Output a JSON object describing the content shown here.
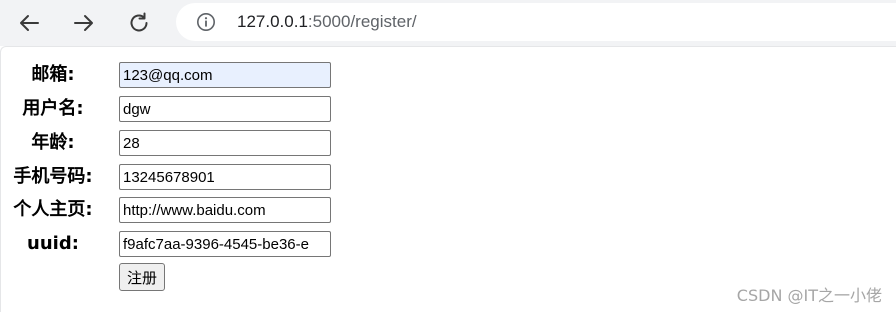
{
  "browser": {
    "url_host": "127.0.0.1",
    "url_path": ":5000/register/"
  },
  "form": {
    "fields": [
      {
        "label": "邮箱:",
        "value": "123@qq.com"
      },
      {
        "label": "用户名:",
        "value": "dgw"
      },
      {
        "label": "年龄:",
        "value": "28"
      },
      {
        "label": "手机号码:",
        "value": "13245678901"
      },
      {
        "label": "个人主页:",
        "value": "http://www.baidu.com"
      },
      {
        "label": "uuid:",
        "value": "f9afc7aa-9396-4545-be36-e"
      }
    ],
    "submit_label": "注册"
  },
  "watermark": "CSDN @IT之一小佬",
  "colors": {
    "autofill_background": "#e8f0fe",
    "toolbar_background": "#f2f3f5"
  },
  "icons": {
    "back": "back-arrow-icon",
    "forward": "forward-arrow-icon",
    "reload": "reload-icon",
    "site_info": "info-icon"
  }
}
